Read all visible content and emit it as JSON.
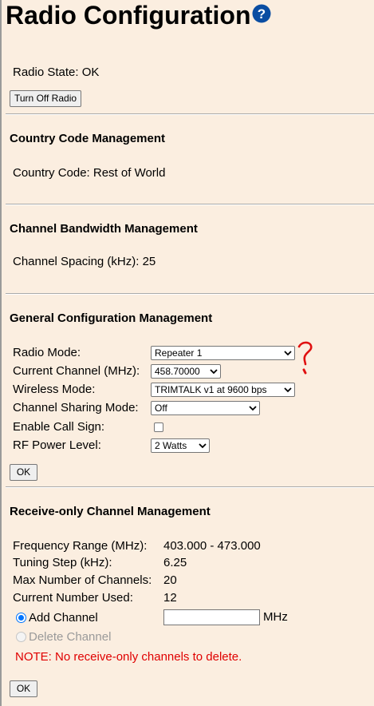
{
  "page": {
    "title": "Radio Configuration"
  },
  "radio_state": {
    "label": "Radio State: OK",
    "turn_off_button": "Turn Off Radio"
  },
  "country": {
    "heading": "Country Code Management",
    "label": "Country Code: Rest of World"
  },
  "bandwidth": {
    "heading": "Channel Bandwidth Management",
    "label": "Channel Spacing (kHz): 25"
  },
  "general": {
    "heading": "General Configuration Management",
    "radio_mode_label": "Radio Mode:",
    "radio_mode_value": "Repeater 1",
    "current_channel_label": "Current Channel (MHz):",
    "current_channel_value": "458.70000",
    "wireless_mode_label": "Wireless Mode:",
    "wireless_mode_value": "TRIMTALK v1 at 9600 bps",
    "channel_sharing_label": "Channel Sharing Mode:",
    "channel_sharing_value": "Off",
    "call_sign_label": "Enable Call Sign:",
    "call_sign_checked": false,
    "rf_power_label": "RF Power Level:",
    "rf_power_value": "2 Watts",
    "ok_button": "OK"
  },
  "receive_only": {
    "heading": "Receive-only Channel Management",
    "freq_range_label": "Frequency Range (MHz):",
    "freq_range_value": "403.000 - 473.000",
    "tuning_step_label": "Tuning Step (kHz):",
    "tuning_step_value": "6.25",
    "max_channels_label": "Max Number of Channels:",
    "max_channels_value": "20",
    "current_used_label": "Current Number Used:",
    "current_used_value": "12",
    "add_channel_label": "Add Channel",
    "add_channel_input": "",
    "mhz_unit": "MHz",
    "delete_channel_label": "Delete Channel",
    "note": "NOTE: No receive-only channels to delete.",
    "ok_button": "OK"
  },
  "colors": {
    "background": "#fbeee0",
    "note_red": "#e00000",
    "help_blue": "#0a4da2",
    "annotation_red": "#e01010"
  },
  "icons": {
    "help": "question-circle-icon",
    "annotation": "handwritten-question-mark"
  }
}
